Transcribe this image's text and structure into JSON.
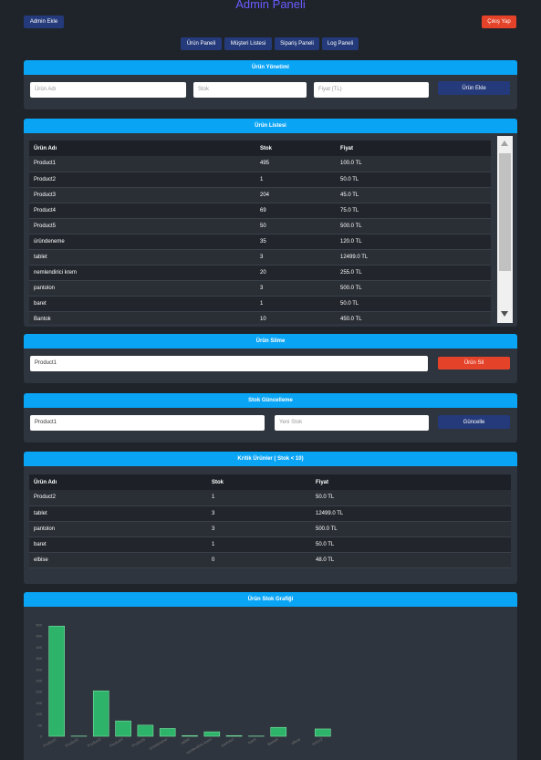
{
  "page_title": "Admin Paneli",
  "top": {
    "admin_add": "Admin Ekle",
    "logout": "Çıkış Yap"
  },
  "nav": [
    "Ürün Paneli",
    "Müşteri Listesi",
    "Sipariş Paneli",
    "Log Paneli"
  ],
  "product_mgmt": {
    "title": "Ürün Yönetimi",
    "name_placeholder": "Ürün Adı",
    "stock_placeholder": "Stok",
    "price_placeholder": "Fiyat (TL)",
    "add_label": "Ürün Ekle"
  },
  "product_list": {
    "title": "Ürün Listesi",
    "headers": [
      "Ürün Adı",
      "Stok",
      "Fiyat"
    ],
    "rows": [
      [
        "Product1",
        "495",
        "100.0 TL"
      ],
      [
        "Product2",
        "1",
        "50.0 TL"
      ],
      [
        "Product3",
        "204",
        "45.0 TL"
      ],
      [
        "Product4",
        "69",
        "75.0 TL"
      ],
      [
        "Product5",
        "50",
        "500.0 TL"
      ],
      [
        "üründeneme",
        "35",
        "120.0 TL"
      ],
      [
        "tablet",
        "3",
        "12499.0 TL"
      ],
      [
        "nemlendirici krem",
        "20",
        "255.0 TL"
      ],
      [
        "pantolon",
        "3",
        "500.0 TL"
      ],
      [
        "baret",
        "1",
        "50.0 TL"
      ],
      [
        "Bantok",
        "10",
        "450.0 TL"
      ]
    ]
  },
  "product_delete": {
    "title": "Ürün Silme",
    "value": "Product1",
    "delete_label": "Ürün Sil"
  },
  "stock_update": {
    "title": "Stok Güncelleme",
    "value": "Product1",
    "new_stock_placeholder": "Yeni Stok",
    "update_label": "Güncelle"
  },
  "critical": {
    "title": "Kritik Ürünler ( Stok < 10)",
    "headers": [
      "Ürün Adı",
      "Stok",
      "Fiyat"
    ],
    "rows": [
      [
        "Product2",
        "1",
        "50.0 TL"
      ],
      [
        "tablet",
        "3",
        "12499.0 TL"
      ],
      [
        "pantolon",
        "3",
        "500.0 TL"
      ],
      [
        "baret",
        "1",
        "50.0 TL"
      ],
      [
        "elbise",
        "0",
        "48.0 TL"
      ]
    ]
  },
  "chart_section": {
    "title": "Ürün Stok Grafiği"
  },
  "chart_data": {
    "type": "bar",
    "categories": [
      "Product1",
      "Product2",
      "Product3",
      "Product4",
      "Product5",
      "üründeneme",
      "tablet",
      "nemlendirici krem",
      "pantolon",
      "baret",
      "Bantok",
      "elbise",
      "ürün12"
    ],
    "values": [
      495,
      1,
      204,
      69,
      50,
      35,
      3,
      20,
      3,
      1,
      40,
      0,
      33
    ],
    "ylim": [
      0,
      500
    ],
    "yticks": [
      0,
      50,
      100,
      150,
      200,
      250,
      300,
      350,
      400,
      450,
      500
    ],
    "bar_color": "#2eb36a",
    "bar_edge": "#7de0a4",
    "grid": false
  }
}
